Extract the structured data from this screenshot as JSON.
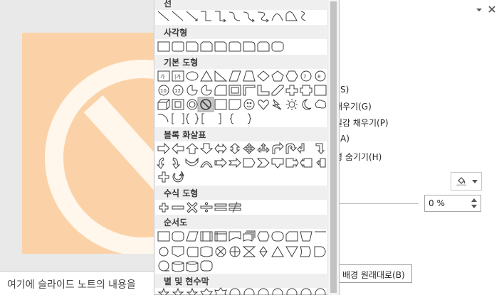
{
  "gallery": {
    "categories": [
      {
        "label": "선",
        "count": 12
      },
      {
        "label": "사각형",
        "count": 9
      },
      {
        "label": "기본 도형",
        "count": 42
      },
      {
        "label": "블록 화살표",
        "count": 28
      },
      {
        "label": "수식 도형",
        "count": 6
      },
      {
        "label": "순서도",
        "count": 28
      },
      {
        "label": "별 및 현수막",
        "count": 12
      }
    ],
    "selected_shape": "no-symbol-shape"
  },
  "notes": {
    "placeholder": "여기에 슬라이드 노트의 내용을"
  },
  "pane": {
    "options": [
      "l(S)",
      "채우기(G)",
      "질감 채우기(P)",
      "l(A)",
      "경 숨기기(H)"
    ],
    "transparency_value": "0 %",
    "reset_label": "배경 원래대로(B)",
    "close_icon": "close-icon",
    "menu_icon": "chevron-down-icon"
  },
  "colors": {
    "slide_bg": "#fbd2a7",
    "symbol": "#fff6ec",
    "selected_shape_bg": "#c6c6c6",
    "accent": "#262626"
  }
}
